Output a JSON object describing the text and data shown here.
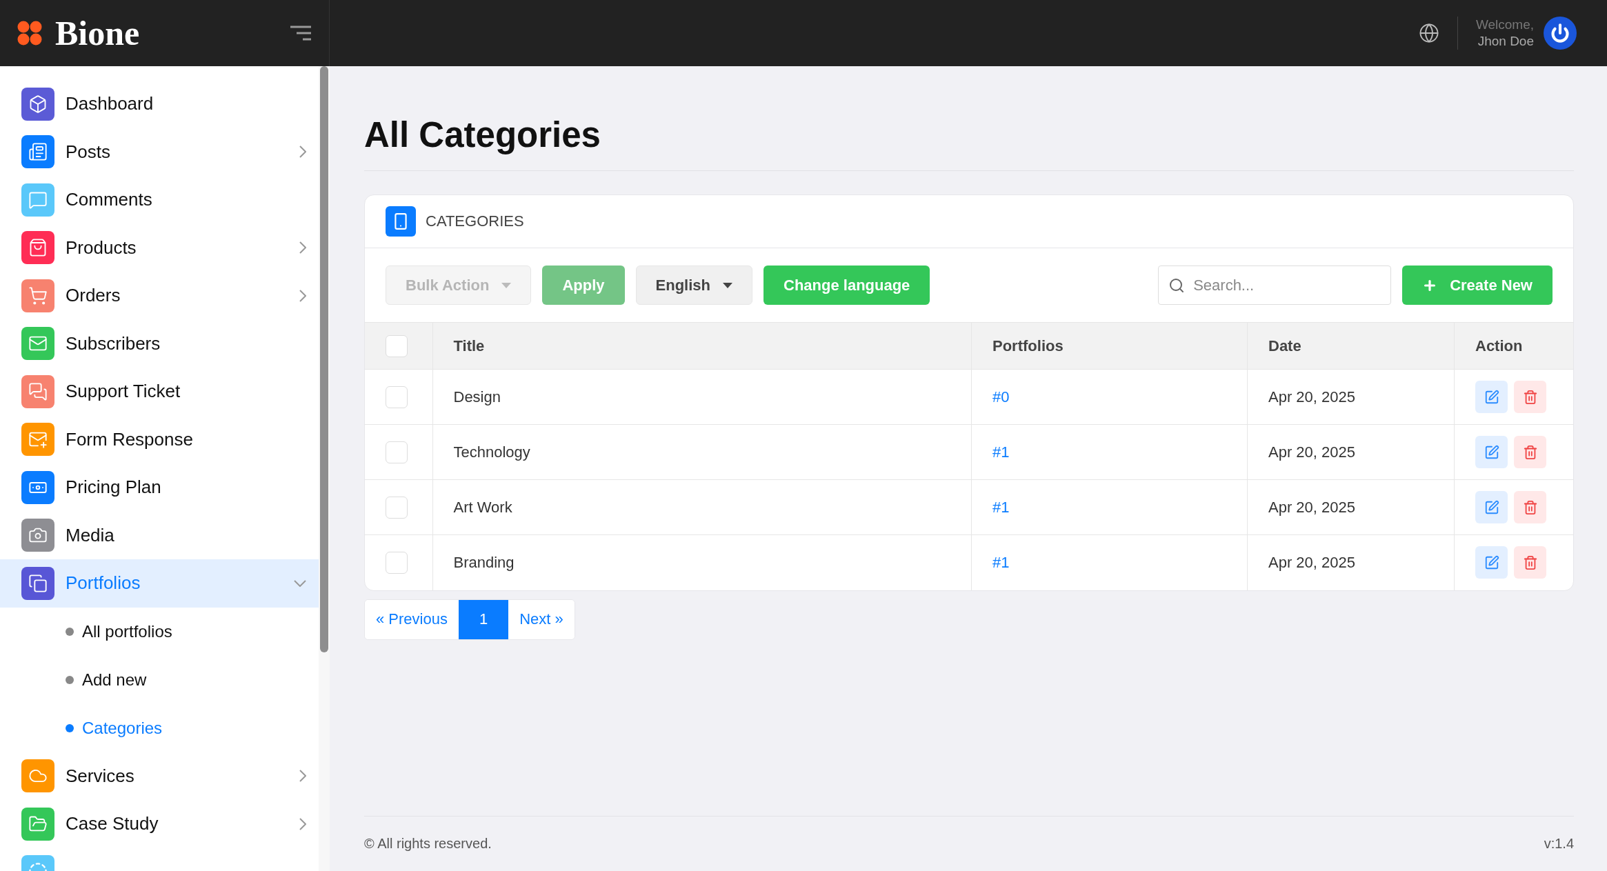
{
  "brand": {
    "name": "Bione"
  },
  "header": {
    "welcome": "Welcome,",
    "user": "Jhon Doe"
  },
  "sidebar": {
    "items": [
      {
        "label": "Dashboard",
        "kind": "link",
        "selected": false,
        "color": "#5b5bd6"
      },
      {
        "label": "Posts",
        "kind": "group",
        "expanded": false,
        "selected": false,
        "color": "#0a7cff"
      },
      {
        "label": "Comments",
        "kind": "link",
        "selected": false,
        "color": "#5ac8fa"
      },
      {
        "label": "Products",
        "kind": "group",
        "expanded": false,
        "selected": false,
        "color": "#ff2d55"
      },
      {
        "label": "Orders",
        "kind": "group",
        "expanded": false,
        "selected": false,
        "color": "#f7826f"
      },
      {
        "label": "Subscribers",
        "kind": "link",
        "selected": false,
        "color": "#34c759"
      },
      {
        "label": "Support Ticket",
        "kind": "link",
        "selected": false,
        "color": "#f7826f"
      },
      {
        "label": "Form Response",
        "kind": "link",
        "selected": false,
        "color": "#ff9500"
      },
      {
        "label": "Pricing Plan",
        "kind": "link",
        "selected": false,
        "color": "#0a7cff"
      },
      {
        "label": "Media",
        "kind": "link",
        "selected": false,
        "color": "#8e8e93"
      },
      {
        "label": "Portfolios",
        "kind": "group",
        "expanded": true,
        "selected": true,
        "color": "#5856d6",
        "children": [
          {
            "label": "All portfolios",
            "selected": false
          },
          {
            "label": "Add new",
            "selected": false
          },
          {
            "label": "Categories",
            "selected": true
          }
        ]
      },
      {
        "label": "Services",
        "kind": "group",
        "expanded": false,
        "selected": false,
        "color": "#ff9500"
      },
      {
        "label": "Case Study",
        "kind": "group",
        "expanded": false,
        "selected": false,
        "color": "#34c759"
      }
    ]
  },
  "page": {
    "title": "All Categories"
  },
  "card": {
    "title": "CATEGORIES",
    "toolbar": {
      "bulk_action": {
        "label": "Bulk Action",
        "disabled": true
      },
      "apply": {
        "label": "Apply",
        "disabled": true
      },
      "language": "English",
      "change_language": "Change language",
      "search": {
        "placeholder": "Search..."
      },
      "create": "Create New"
    },
    "table": {
      "select_all": {
        "checked": false
      },
      "columns": [
        "Title",
        "Portfolios",
        "Date",
        "Action"
      ],
      "rows": [
        {
          "checked": false,
          "title": "Design",
          "portfolios": "#0",
          "date": "Apr 20, 2025"
        },
        {
          "checked": false,
          "title": "Technology",
          "portfolios": "#1",
          "date": "Apr 20, 2025"
        },
        {
          "checked": false,
          "title": "Art Work",
          "portfolios": "#1",
          "date": "Apr 20, 2025"
        },
        {
          "checked": false,
          "title": "Branding",
          "portfolios": "#1",
          "date": "Apr 20, 2025"
        }
      ]
    }
  },
  "pagination": {
    "previous": "« Previous",
    "pages": [
      {
        "label": "1",
        "selected": true
      }
    ],
    "next": "Next »"
  },
  "footer": {
    "copyright": "© All rights reserved.",
    "version": "v:1.4"
  }
}
